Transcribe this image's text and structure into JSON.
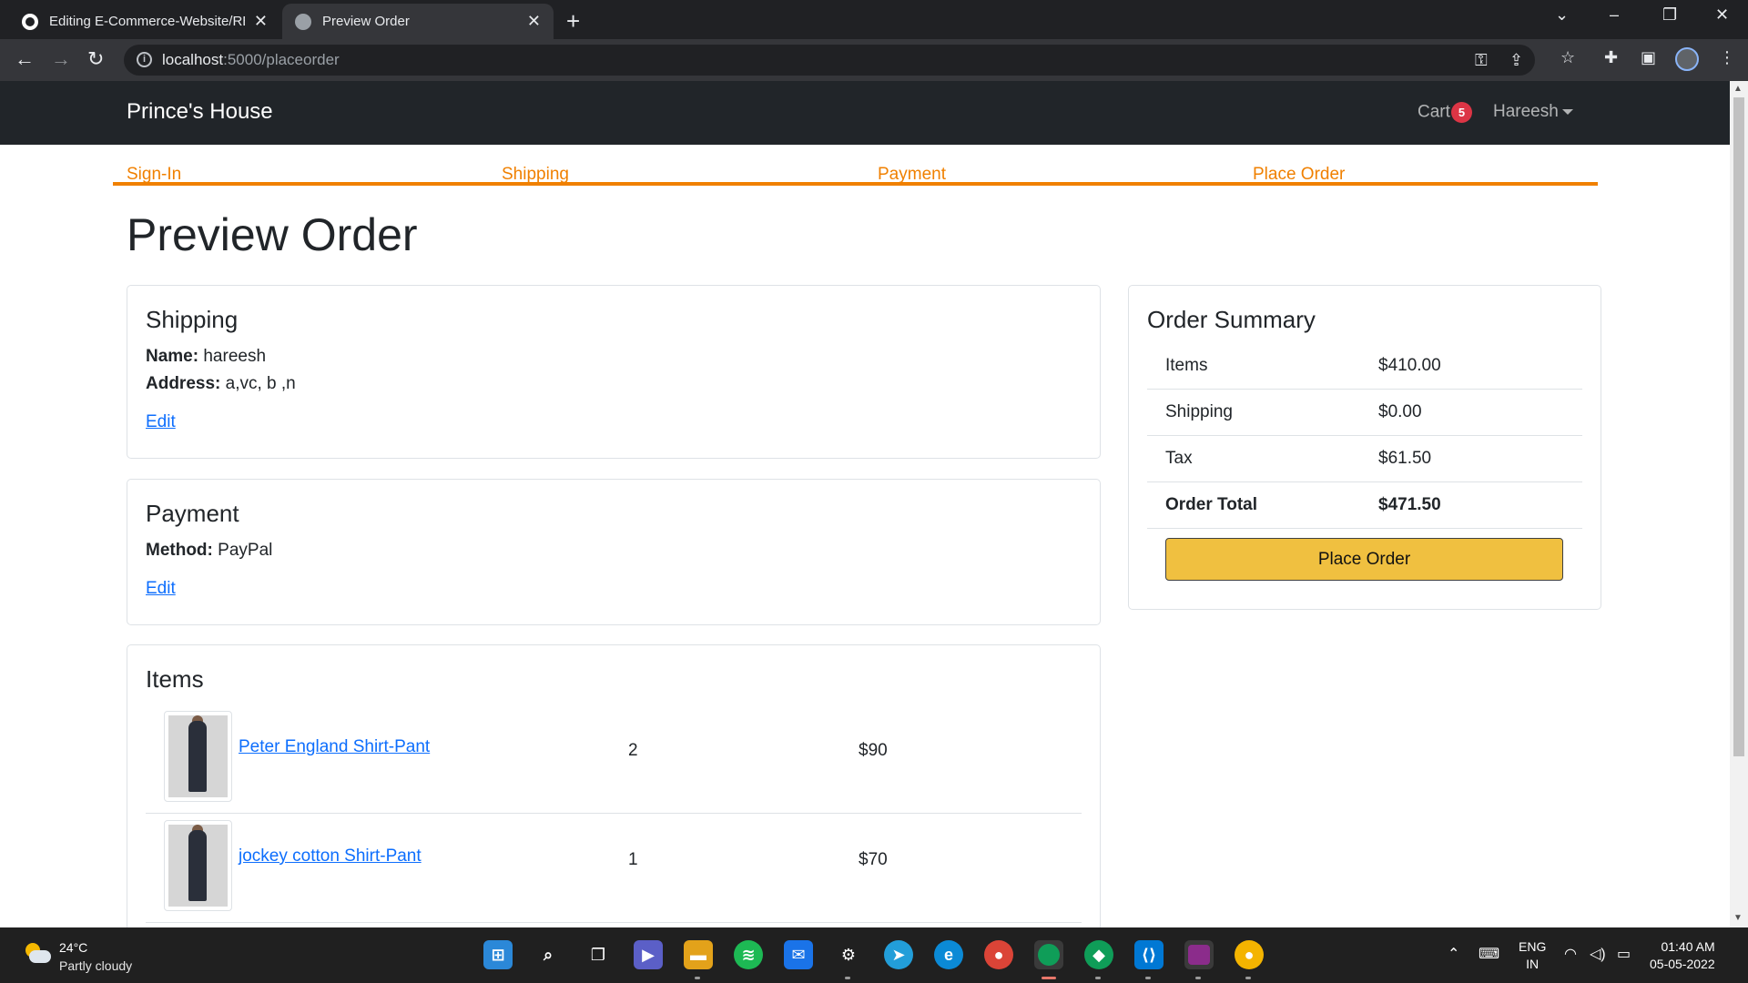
{
  "browser": {
    "tabs": [
      {
        "title": "Editing E-Commerce-Website/RE",
        "favicon": "github-icon",
        "active": false
      },
      {
        "title": "Preview Order",
        "favicon": "globe-icon",
        "active": true
      }
    ],
    "url_host": "localhost",
    "url_path": ":5000/placeorder"
  },
  "navbar": {
    "brand": "Prince's House",
    "cart_label": "Cart",
    "cart_count": "5",
    "user_name": "Hareesh"
  },
  "steps": [
    "Sign-In",
    "Shipping",
    "Payment",
    "Place Order"
  ],
  "page_title": "Preview Order",
  "shipping": {
    "title": "Shipping",
    "name_label": "Name:",
    "name_value": "hareesh",
    "address_label": "Address:",
    "address_value": "a,vc, b ,n",
    "edit_label": "Edit"
  },
  "payment": {
    "title": "Payment",
    "method_label": "Method:",
    "method_value": "PayPal",
    "edit_label": "Edit"
  },
  "items": {
    "title": "Items",
    "rows": [
      {
        "name": "Peter England Shirt-Pant",
        "qty": "2",
        "price": "$90"
      },
      {
        "name": "jockey cotton Shirt-Pant",
        "qty": "1",
        "price": "$70"
      }
    ]
  },
  "summary": {
    "title": "Order Summary",
    "rows": [
      {
        "label": "Items",
        "value": "$410.00"
      },
      {
        "label": "Shipping",
        "value": "$0.00"
      },
      {
        "label": "Tax",
        "value": "$61.50"
      },
      {
        "label": "Order Total",
        "value": "$471.50"
      }
    ],
    "button_label": "Place Order"
  },
  "taskbar": {
    "temperature": "24°C",
    "condition": "Partly cloudy",
    "lang_top": "ENG",
    "lang_bottom": "IN",
    "time": "01:40 AM",
    "date": "05-05-2022"
  },
  "colors": {
    "navbar_bg": "#212529",
    "step_accent": "#f08000",
    "link": "#0d6efd",
    "place_order_button": "#f0c040",
    "cart_badge": "#dc3545"
  }
}
